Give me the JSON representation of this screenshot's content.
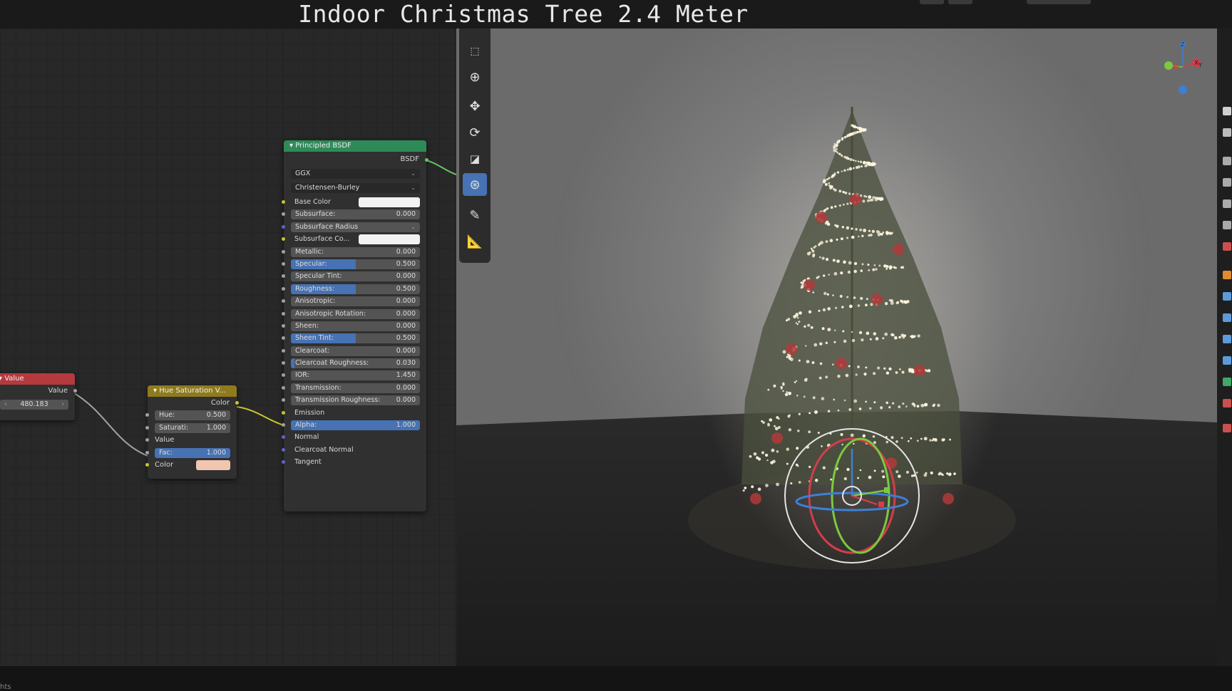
{
  "title": "Indoor Christmas Tree 2.4 Meter",
  "status_bar": {
    "text": "hts"
  },
  "value_node": {
    "header": "Value",
    "output": "Value",
    "field_value": "480.183"
  },
  "hue_node": {
    "header": "Hue Saturation V...",
    "output": "Color",
    "hue_label": "Hue:",
    "hue_value": "0.500",
    "sat_label": "Saturati:",
    "sat_value": "1.000",
    "value_label": "Value",
    "fac_label": "Fac:",
    "fac_value": "1.000",
    "fac_fraction": 1.0,
    "color_label": "Color",
    "color_swatch": "#f0c6b0"
  },
  "bsdf_node": {
    "header": "Principled BSDF",
    "output": "BSDF",
    "distribution": "GGX",
    "subsurface_method": "Christensen-Burley",
    "base_color_label": "Base Color",
    "subsurface_radius_label": "Subsurface Radius",
    "subsurface_color_label": "Subsurface Co...",
    "fields": [
      {
        "label": "Subsurface:",
        "value": "0.000",
        "fraction": 0.0
      },
      {
        "label": "Metallic:",
        "value": "0.000",
        "fraction": 0.0
      },
      {
        "label": "Specular:",
        "value": "0.500",
        "fraction": 0.5
      },
      {
        "label": "Specular Tint:",
        "value": "0.000",
        "fraction": 0.0
      },
      {
        "label": "Roughness:",
        "value": "0.500",
        "fraction": 0.5
      },
      {
        "label": "Anisotropic:",
        "value": "0.000",
        "fraction": 0.0
      },
      {
        "label": "Anisotropic Rotation:",
        "value": "0.000",
        "fraction": 0.0
      },
      {
        "label": "Sheen:",
        "value": "0.000",
        "fraction": 0.0
      },
      {
        "label": "Sheen Tint:",
        "value": "0.500",
        "fraction": 0.5
      },
      {
        "label": "Clearcoat:",
        "value": "0.000",
        "fraction": 0.0
      },
      {
        "label": "Clearcoat Roughness:",
        "value": "0.030",
        "fraction": 0.03
      },
      {
        "label": "IOR:",
        "value": "1.450",
        "fraction": 0.0
      },
      {
        "label": "Transmission:",
        "value": "0.000",
        "fraction": 0.0
      },
      {
        "label": "Transmission Roughness:",
        "value": "0.000",
        "fraction": 0.0
      }
    ],
    "emission_label": "Emission",
    "alpha_label": "Alpha:",
    "alpha_value": "1.000",
    "alpha_fraction": 1.0,
    "normal_label": "Normal",
    "clearcoat_normal_label": "Clearcoat Normal",
    "tangent_label": "Tangent"
  },
  "colors": {
    "value_header": "#b53a3e",
    "hue_header": "#8f7b1e",
    "bsdf_header": "#2e8b57",
    "slider_fill": "#4772b3",
    "white_swatch": "#f2f2f2"
  },
  "gizmo_axes": {
    "x": "X",
    "y": "Y",
    "z": "Z"
  },
  "toolbar_icons": [
    "select-box-icon",
    "cursor-icon",
    "move-icon",
    "rotate-icon",
    "scale-icon",
    "transform-icon",
    "annotate-icon",
    "measure-icon"
  ]
}
